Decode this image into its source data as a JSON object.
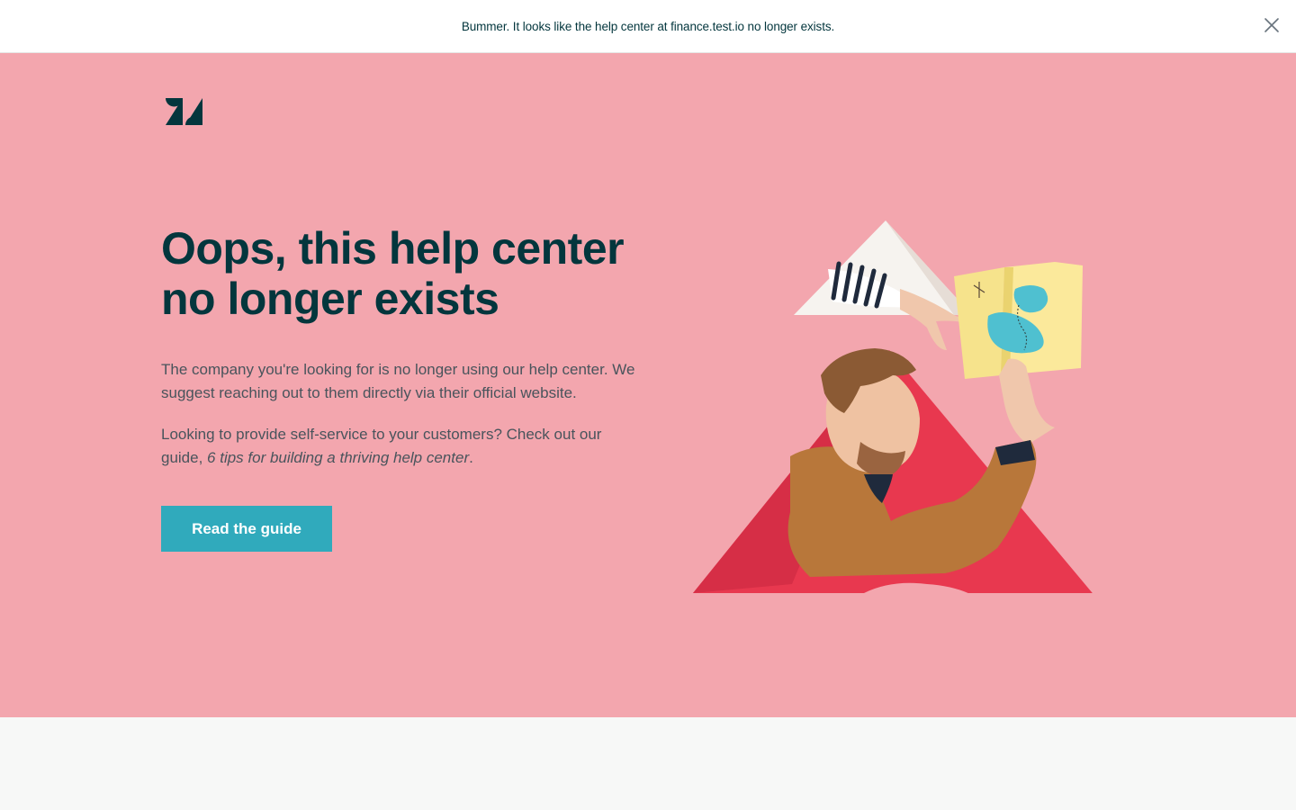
{
  "banner": {
    "message": "Bummer. It looks like the help center at finance.test.io no longer exists.",
    "close_icon": "close-icon"
  },
  "brand": {
    "logo_icon": "zendesk-logo-icon"
  },
  "main": {
    "title_line1": "Oops, this help center",
    "title_line2": "no longer exists",
    "para1": "The company you're looking for is no longer using our help center. We suggest reaching out to them directly via their official website.",
    "para2_prefix": "Looking to provide self-service to your customers? Check out our guide, ",
    "para2_link": "6 tips for building a thriving help center",
    "para2_suffix": ".",
    "cta_label": "Read the guide"
  },
  "colors": {
    "hero_background": "#f3a6ae",
    "heading": "#03363d",
    "body_text": "#49545c",
    "cta_background": "#30aabc",
    "accent_red": "#e8384f"
  }
}
